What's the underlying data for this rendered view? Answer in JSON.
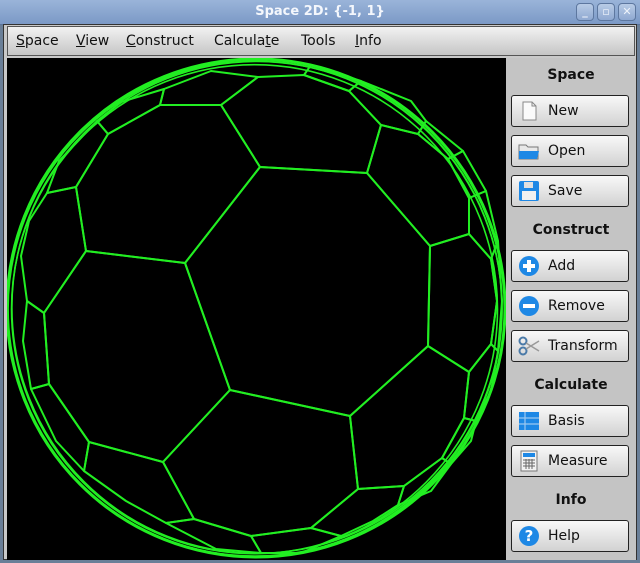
{
  "window": {
    "title": "Space 2D: {-1, 1}",
    "controls": {
      "minimize": "_",
      "maximize": "▫",
      "close": "✕"
    }
  },
  "menubar": {
    "items": [
      {
        "label": "Space",
        "mnemonic": "S"
      },
      {
        "label": "View",
        "mnemonic": "V"
      },
      {
        "label": "Construct",
        "mnemonic": "C"
      },
      {
        "label": "Calculate",
        "mnemonic": "t"
      },
      {
        "label": "Tools",
        "mnemonic": ""
      },
      {
        "label": "Info",
        "mnemonic": "I"
      }
    ]
  },
  "canvas": {
    "background": "#000000",
    "line_color": "#22ee22",
    "content": "truncated-icosahedron-like spherical tiling wireframe (soccer ball)"
  },
  "panel": {
    "sections": [
      {
        "label": "Space",
        "buttons": [
          {
            "label": "New",
            "icon": "new-document-icon"
          },
          {
            "label": "Open",
            "icon": "folder-open-icon"
          },
          {
            "label": "Save",
            "icon": "floppy-save-icon"
          }
        ]
      },
      {
        "label": "Construct",
        "buttons": [
          {
            "label": "Add",
            "icon": "plus-circle-icon"
          },
          {
            "label": "Remove",
            "icon": "minus-circle-icon"
          },
          {
            "label": "Transform",
            "icon": "scissors-icon"
          }
        ]
      },
      {
        "label": "Calculate",
        "buttons": [
          {
            "label": "Basis",
            "icon": "grid-table-icon"
          },
          {
            "label": "Measure",
            "icon": "calculator-icon"
          }
        ]
      },
      {
        "label": "Info",
        "buttons": [
          {
            "label": "Help",
            "icon": "help-circle-icon"
          }
        ]
      }
    ]
  },
  "colors": {
    "titlebar": "#8aa6d0",
    "panel": "#c4c4c4",
    "icon_blue": "#1e88e5"
  }
}
